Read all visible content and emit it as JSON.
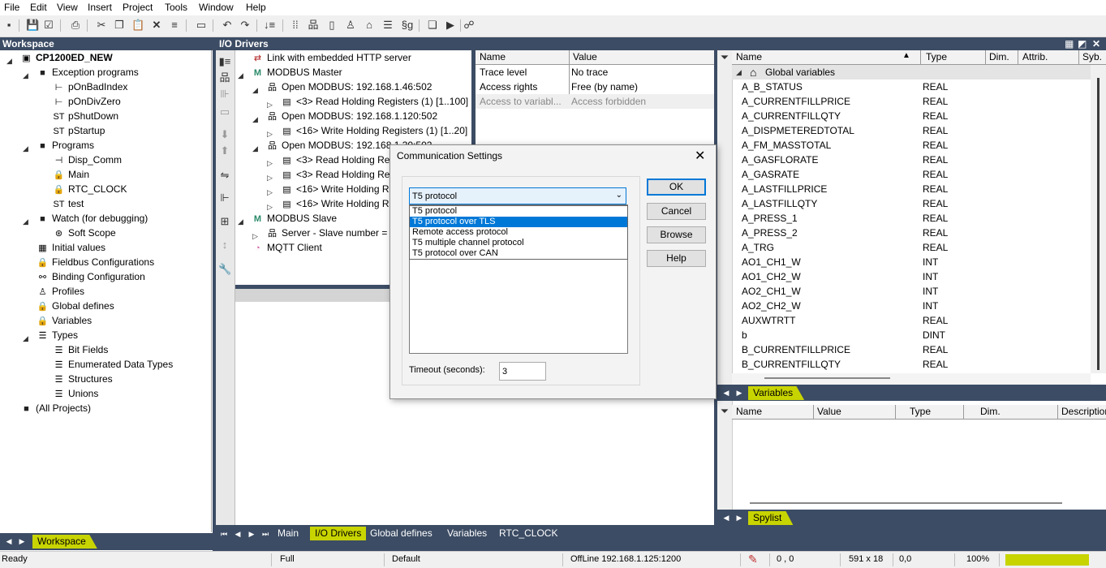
{
  "menu": [
    "File",
    "Edit",
    "View",
    "Insert",
    "Project",
    "Tools",
    "Window",
    "Help"
  ],
  "workspace": {
    "title": "Workspace",
    "tab_label": "Workspace",
    "tree": [
      {
        "label": "CP1200ED_NEW",
        "level": 0,
        "icon": "project-icon",
        "expand": "expanded",
        "bold": true
      },
      {
        "label": "Exception programs",
        "level": 1,
        "icon": "folder-icon",
        "expand": "expanded"
      },
      {
        "label": "pOnBadIndex",
        "level": 2,
        "icon": "sfc-program-icon",
        "expand": "none"
      },
      {
        "label": "pOnDivZero",
        "level": 2,
        "icon": "sfc-program-icon",
        "expand": "none"
      },
      {
        "label": "pShutDown",
        "level": 2,
        "icon": "st-program-icon",
        "expand": "none"
      },
      {
        "label": "pStartup",
        "level": 2,
        "icon": "st-program-icon",
        "expand": "none"
      },
      {
        "label": "Programs",
        "level": 1,
        "icon": "folder-icon",
        "expand": "expanded"
      },
      {
        "label": "Disp_Comm",
        "level": 2,
        "icon": "ld-program-icon",
        "expand": "none"
      },
      {
        "label": "Main",
        "level": 2,
        "icon": "locked-program-icon",
        "expand": "none"
      },
      {
        "label": "RTC_CLOCK",
        "level": 2,
        "icon": "locked-program-icon",
        "expand": "none"
      },
      {
        "label": "test",
        "level": 2,
        "icon": "st-program-icon",
        "expand": "none"
      },
      {
        "label": "Watch (for debugging)",
        "level": 1,
        "icon": "folder-icon",
        "expand": "expanded"
      },
      {
        "label": "Soft Scope",
        "level": 2,
        "icon": "scope-icon",
        "expand": "none"
      },
      {
        "label": "Initial values",
        "level": 1,
        "icon": "grid-icon",
        "expand": "none"
      },
      {
        "label": "Fieldbus Configurations",
        "level": 1,
        "icon": "locked-fieldbus-icon",
        "expand": "none"
      },
      {
        "label": "Binding Configuration",
        "level": 1,
        "icon": "binding-icon",
        "expand": "none"
      },
      {
        "label": "Profiles",
        "level": 1,
        "icon": "user-icon",
        "expand": "none"
      },
      {
        "label": "Global defines",
        "level": 1,
        "icon": "locked-defines-icon",
        "expand": "none"
      },
      {
        "label": "Variables",
        "level": 1,
        "icon": "locked-variables-icon",
        "expand": "none"
      },
      {
        "label": "Types",
        "level": 1,
        "icon": "types-icon",
        "expand": "expanded"
      },
      {
        "label": "Bit Fields",
        "level": 2,
        "icon": "type-icon",
        "expand": "none"
      },
      {
        "label": "Enumerated Data Types",
        "level": 2,
        "icon": "type-icon",
        "expand": "none"
      },
      {
        "label": "Structures",
        "level": 2,
        "icon": "type-icon",
        "expand": "none"
      },
      {
        "label": "Unions",
        "level": 2,
        "icon": "type-icon",
        "expand": "none"
      },
      {
        "label": "(All Projects)",
        "level": 0,
        "icon": "folder-icon",
        "expand": "none"
      }
    ]
  },
  "io": {
    "title": "I/O Drivers",
    "tree": [
      {
        "label": "Link with embedded HTTP server",
        "level": 0,
        "icon": "link-icon",
        "expand": "none"
      },
      {
        "label": "MODBUS Master",
        "level": 0,
        "icon": "modbus-icon",
        "expand": "expanded"
      },
      {
        "label": "Open MODBUS: 192.168.1.46:502",
        "level": 1,
        "icon": "network-icon",
        "expand": "expanded"
      },
      {
        "label": "<3> Read Holding Registers (1) [1..100]",
        "level": 2,
        "icon": "register-icon",
        "expand": "collapsed"
      },
      {
        "label": "Open MODBUS: 192.168.1.120:502",
        "level": 1,
        "icon": "network-icon",
        "expand": "expanded"
      },
      {
        "label": "<16> Write Holding Registers (1) [1..20]",
        "level": 2,
        "icon": "register-icon",
        "expand": "collapsed"
      },
      {
        "label": "Open MODBUS: 192.168.1.30:502",
        "level": 1,
        "icon": "network-icon",
        "expand": "expanded"
      },
      {
        "label": "<3> Read Holding Re",
        "level": 2,
        "icon": "register-icon",
        "expand": "collapsed"
      },
      {
        "label": "<3> Read Holding Re",
        "level": 2,
        "icon": "register-icon",
        "expand": "collapsed"
      },
      {
        "label": "<16> Write Holding R",
        "level": 2,
        "icon": "register-icon",
        "expand": "collapsed"
      },
      {
        "label": "<16> Write Holding R",
        "level": 2,
        "icon": "register-icon",
        "expand": "collapsed"
      },
      {
        "label": "MODBUS Slave",
        "level": 0,
        "icon": "modbus-icon",
        "expand": "expanded"
      },
      {
        "label": "Server - Slave number =",
        "level": 1,
        "icon": "network-icon",
        "expand": "collapsed"
      },
      {
        "label": "MQTT Client",
        "level": 0,
        "icon": "mqtt-icon",
        "expand": "none"
      }
    ],
    "props": {
      "headers": [
        "Name",
        "Value"
      ],
      "rows": [
        {
          "name": "Trace level",
          "value": "No trace",
          "disabled": false
        },
        {
          "name": "Access rights",
          "value": "Free (by name)",
          "disabled": false
        },
        {
          "name": "Access to variabl...",
          "value": "Access forbidden",
          "disabled": true
        }
      ]
    }
  },
  "variables": {
    "headers": [
      "Name",
      "Type",
      "Dim.",
      "Attrib.",
      "Syb."
    ],
    "group": "Global variables",
    "rows": [
      {
        "name": "A_B_STATUS",
        "type": "REAL"
      },
      {
        "name": "A_CURRENTFILLPRICE",
        "type": "REAL"
      },
      {
        "name": "A_CURRENTFILLQTY",
        "type": "REAL"
      },
      {
        "name": "A_DISPMETEREDTOTAL",
        "type": "REAL"
      },
      {
        "name": "A_FM_MASSTOTAL",
        "type": "REAL"
      },
      {
        "name": "A_GASFLORATE",
        "type": "REAL"
      },
      {
        "name": "A_GASRATE",
        "type": "REAL"
      },
      {
        "name": "A_LASTFILLPRICE",
        "type": "REAL"
      },
      {
        "name": "A_LASTFILLQTY",
        "type": "REAL"
      },
      {
        "name": "A_PRESS_1",
        "type": "REAL"
      },
      {
        "name": "A_PRESS_2",
        "type": "REAL"
      },
      {
        "name": "A_TRG",
        "type": "REAL"
      },
      {
        "name": "AO1_CH1_W",
        "type": "INT"
      },
      {
        "name": "AO1_CH2_W",
        "type": "INT"
      },
      {
        "name": "AO2_CH1_W",
        "type": "INT"
      },
      {
        "name": "AO2_CH2_W",
        "type": "INT"
      },
      {
        "name": "AUXWTRTT",
        "type": "REAL"
      },
      {
        "name": "b",
        "type": "DINT"
      },
      {
        "name": "B_CURRENTFILLPRICE",
        "type": "REAL"
      },
      {
        "name": "B_CURRENTFILLQTY",
        "type": "REAL"
      }
    ],
    "tab_label": "Variables"
  },
  "spylist": {
    "headers": [
      "Name",
      "Value",
      "Type",
      "Dim.",
      "Description"
    ],
    "tab_label": "Spylist"
  },
  "doc_tabs": [
    {
      "label": "Main",
      "active": false
    },
    {
      "label": "I/O Drivers",
      "active": true
    },
    {
      "label": "Global defines",
      "active": false
    },
    {
      "label": "Variables",
      "active": false
    },
    {
      "label": "RTC_CLOCK",
      "active": false
    }
  ],
  "dialog": {
    "title": "Communication Settings",
    "selected": "T5 protocol",
    "options": [
      "T5 protocol",
      "T5 protocol over TLS",
      "Remote access protocol",
      "T5 multiple channel protocol",
      "T5 protocol over CAN"
    ],
    "highlighted_index": 1,
    "ok": "OK",
    "cancel": "Cancel",
    "browse": "Browse",
    "help": "Help",
    "timeout_label": "Timeout (seconds):",
    "timeout_value": "3"
  },
  "status": {
    "ready": "Ready",
    "mode": "Full",
    "default": "Default",
    "connection": "OffLine  192.168.1.125:1200",
    "cursor": "0 , 0",
    "size": "591 x 18",
    "pos": "0,0",
    "zoom": "100%"
  },
  "colors": {
    "header": "#3c4c64",
    "accent": "#c8d400",
    "selection": "#0078d7"
  }
}
